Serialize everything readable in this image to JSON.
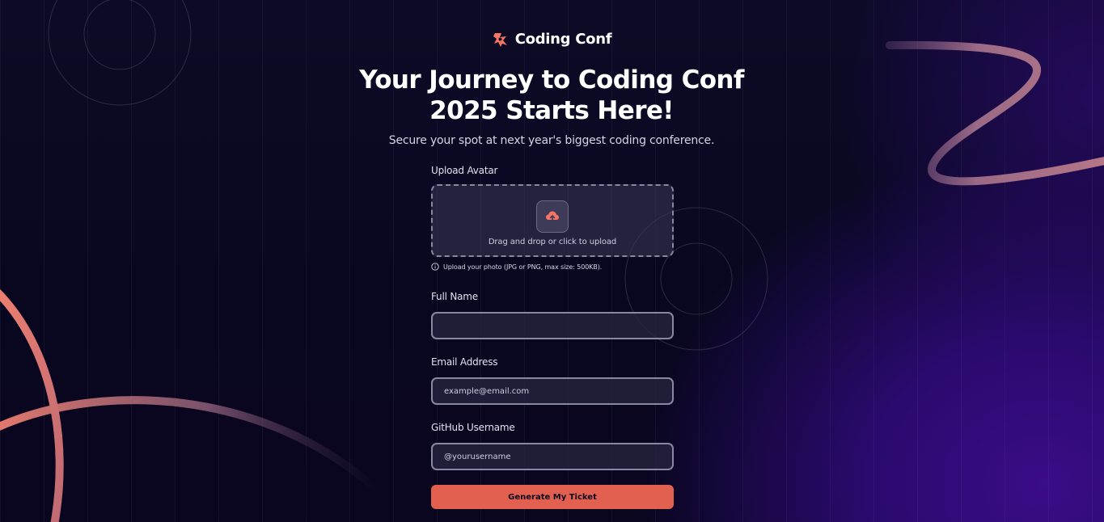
{
  "brand": {
    "name": "Coding Conf",
    "logo_icon": "coding-conf-logo-icon",
    "accent_color": "#f57463"
  },
  "hero": {
    "title": "Your Journey to Coding Conf 2025 Starts Here!",
    "subtitle": "Secure your spot at next year's biggest coding conference."
  },
  "form": {
    "avatar": {
      "label": "Upload Avatar",
      "dropzone_text": "Drag and drop or click to upload",
      "upload_icon": "cloud-upload-icon",
      "hint_icon": "info-icon",
      "hint": "Upload your photo (JPG or PNG, max size: 500KB)."
    },
    "full_name": {
      "label": "Full Name",
      "value": "",
      "placeholder": ""
    },
    "email": {
      "label": "Email Address",
      "value": "",
      "placeholder": "example@email.com"
    },
    "github": {
      "label": "GitHub Username",
      "value": "",
      "placeholder": "@yourusername"
    },
    "submit_label": "Generate My Ticket"
  },
  "colors": {
    "background_dark": "#0c0a26",
    "background_purple": "#3a0c86",
    "button": "#e1604f",
    "border": "#8a87a3"
  }
}
